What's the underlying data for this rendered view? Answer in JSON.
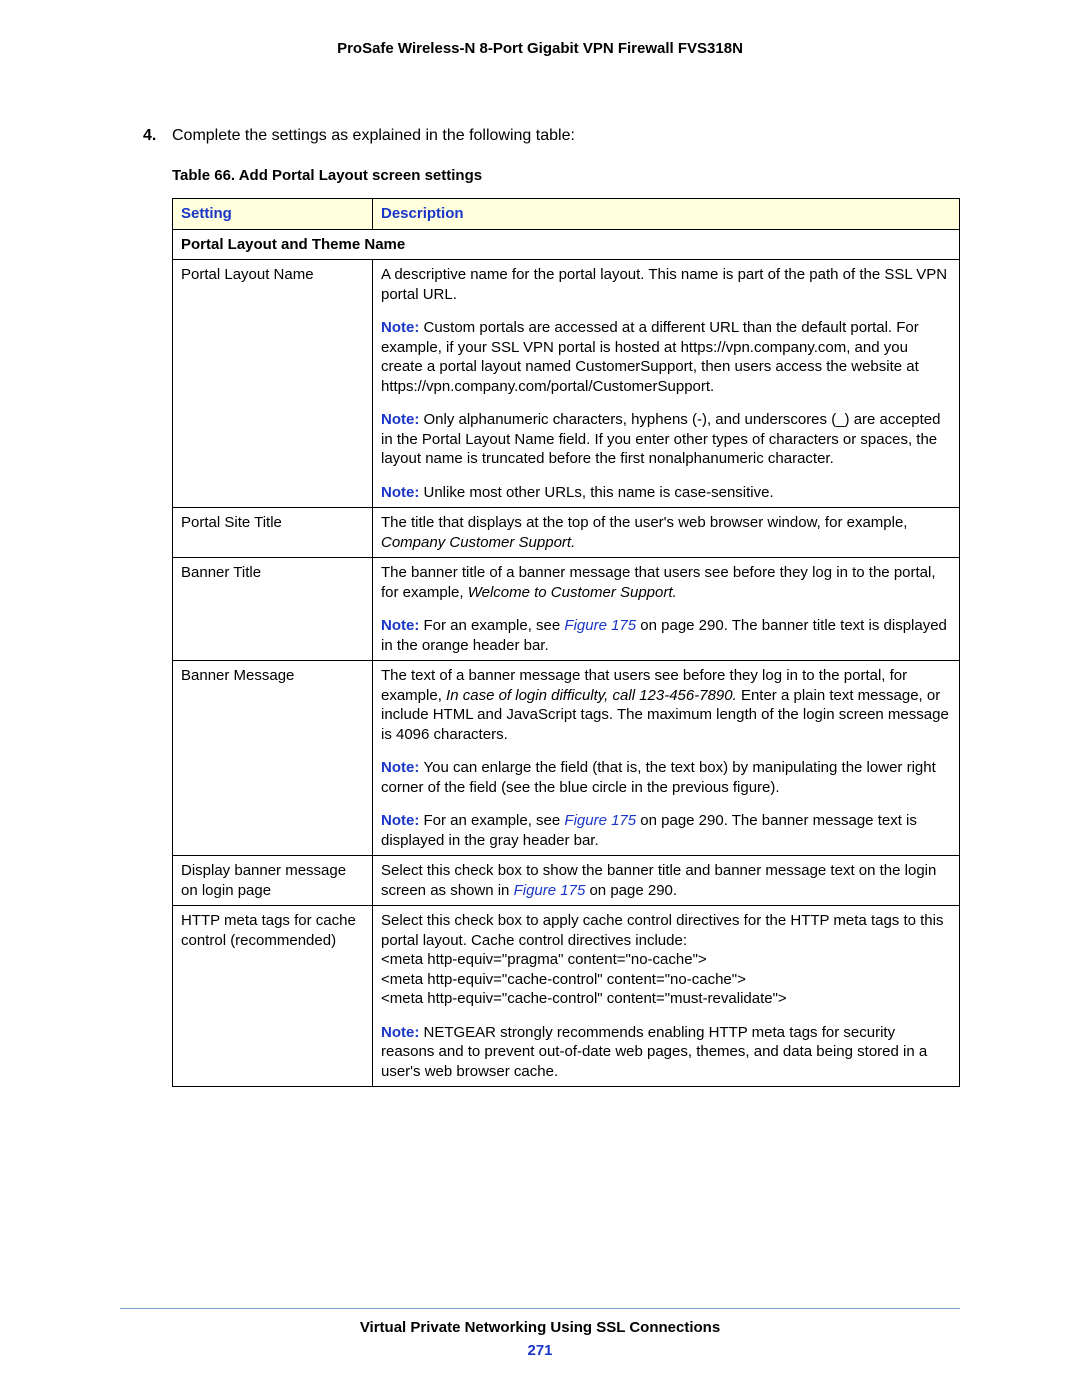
{
  "header": "ProSafe Wireless-N 8-Port Gigabit VPN Firewall FVS318N",
  "step": {
    "num": "4.",
    "text": "Complete the settings as explained in the following table:"
  },
  "caption": "Table 66.  Add Portal Layout screen settings",
  "columns": {
    "setting": "Setting",
    "description": "Description"
  },
  "section1": "Portal Layout and Theme Name",
  "rows": {
    "r1": {
      "setting": "Portal Layout Name",
      "d1": "A descriptive name for the portal layout. This name is part of the path of the SSL VPN portal URL.",
      "d2": "Custom portals are accessed at a different URL than the default portal. For example, if your SSL VPN portal is hosted at https://vpn.company.com, and you create a portal layout named CustomerSupport, then users access the website at https://vpn.company.com/portal/CustomerSupport.",
      "d3": "Only alphanumeric characters, hyphens (-), and underscores (_) are accepted in the Portal Layout Name field. If you enter other types of characters or spaces, the layout name is truncated before the first nonalphanumeric character.",
      "d4": "Unlike most other URLs, this name is case-sensitive."
    },
    "r2": {
      "setting": "Portal Site Title",
      "d1a": "The title that displays at the top of the user's web browser window, for example, ",
      "d1b": "Company Customer Support."
    },
    "r3": {
      "setting": "Banner Title",
      "d1a": "The banner title of a banner message that users see before they log in to the portal, for example, ",
      "d1b": "Welcome to Customer Support.",
      "d2a": "For an example, see ",
      "d2link": "Figure 175",
      "d2b": " on page 290. The banner title text is displayed in the orange header bar."
    },
    "r4": {
      "setting": "Banner Message",
      "d1a": "The text of a banner message that users see before they log in to the portal, for example, ",
      "d1b": "In case of login difficulty, call 123-456-7890.",
      "d1c": " Enter a plain text message, or include HTML and JavaScript tags. The maximum length of the login screen message is 4096 characters.",
      "d2": "You can enlarge the field (that is, the text box) by manipulating the lower right corner of the field (see the blue circle in the previous figure).",
      "d3a": "For an example, see ",
      "d3link": "Figure 175",
      "d3b": " on page 290. The banner message text is displayed in the gray header bar."
    },
    "r5": {
      "setting": "Display banner message on login page",
      "d1a": "Select this check box to show the banner title and banner message text on the login screen as shown in ",
      "d1link": "Figure 175",
      "d1b": " on page 290."
    },
    "r6": {
      "setting": "HTTP meta tags for cache control (recommended)",
      "d1": "Select this check box to apply cache control directives for the HTTP meta tags to this portal layout. Cache control directives include:",
      "m1": "<meta http-equiv=\"pragma\" content=\"no-cache\">",
      "m2": "<meta http-equiv=\"cache-control\" content=\"no-cache\">",
      "m3": "<meta http-equiv=\"cache-control\" content=\"must-revalidate\">",
      "d2": "NETGEAR strongly recommends enabling HTTP meta tags for security reasons and to prevent out-of-date web pages, themes, and data being stored in a user's web browser cache."
    }
  },
  "note": "Note:  ",
  "footer": {
    "title": "Virtual Private Networking Using SSL Connections",
    "page": "271"
  }
}
